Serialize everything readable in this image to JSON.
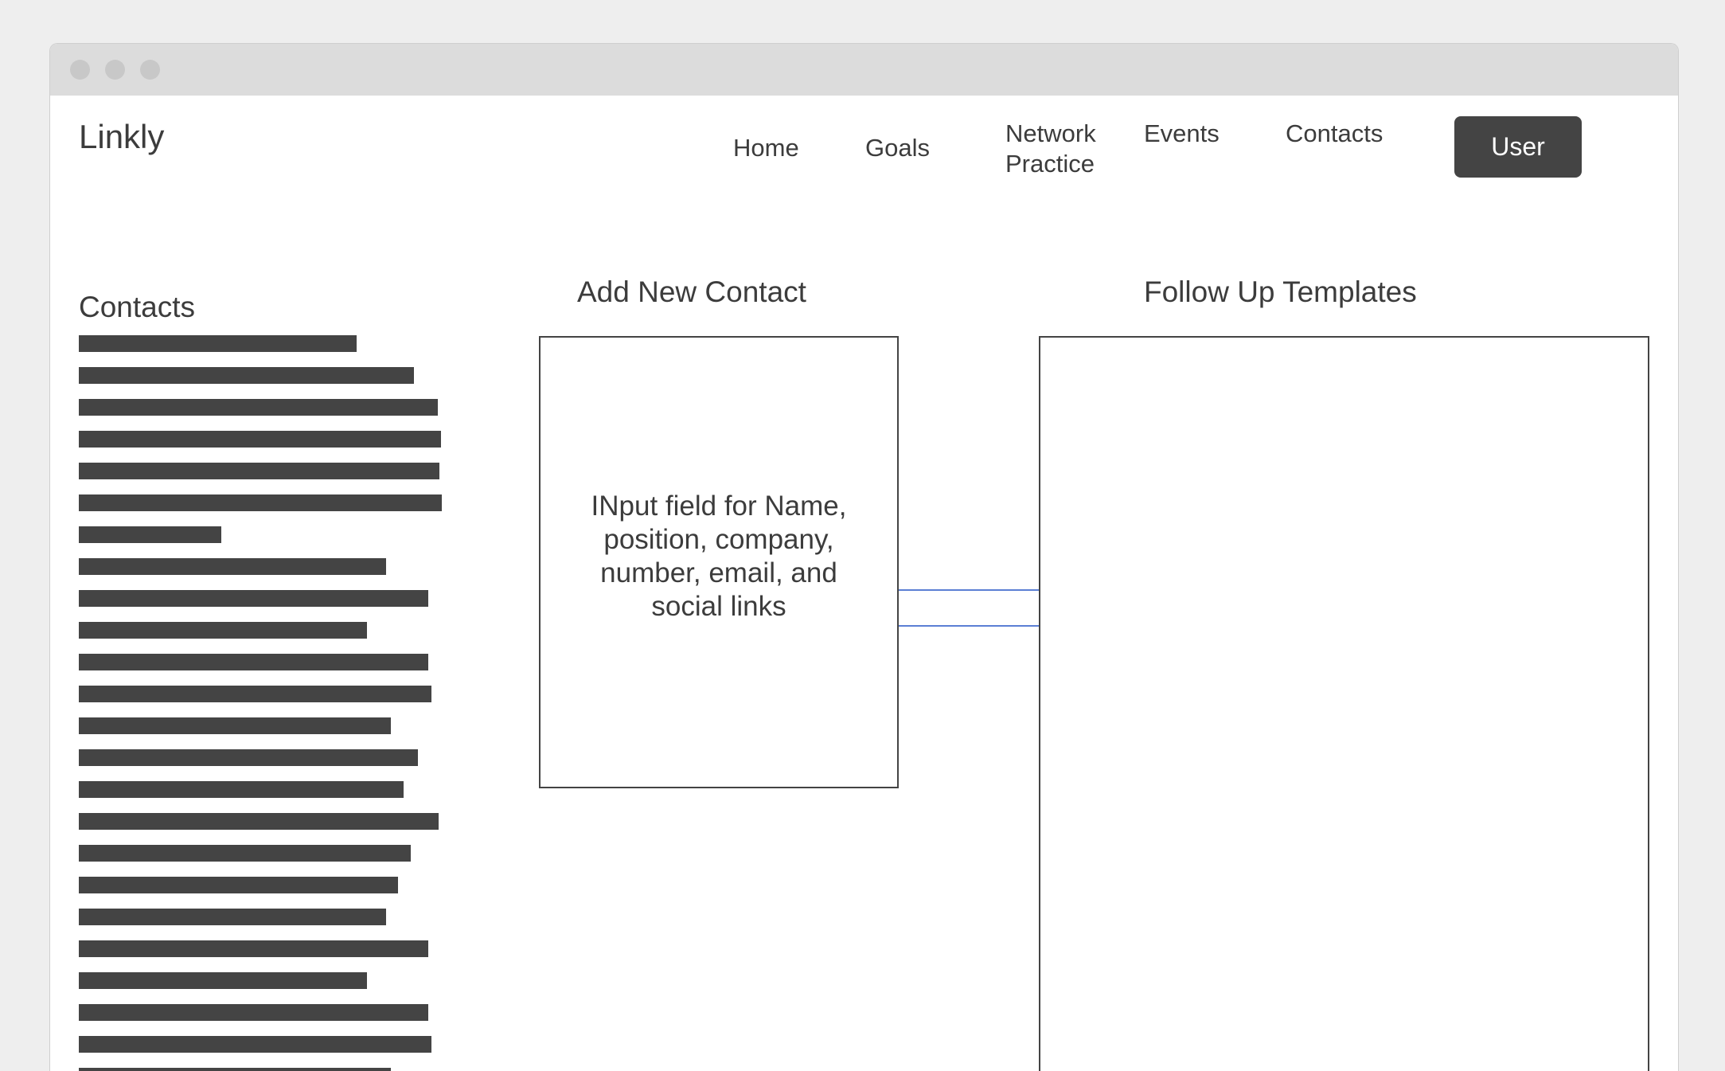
{
  "window": {
    "controls": [
      "close",
      "minimize",
      "maximize"
    ]
  },
  "header": {
    "logo": "Linkly",
    "nav": [
      {
        "label": "Home"
      },
      {
        "label": "Goals"
      },
      {
        "label": "Network Practice"
      },
      {
        "label": "Events"
      },
      {
        "label": "Contacts"
      }
    ],
    "user_label": "User"
  },
  "contacts": {
    "title": "Contacts",
    "rows": 24
  },
  "add_contact": {
    "title": "Add New Contact",
    "placeholder": "INput field for Name, position, company, number, email, and social links"
  },
  "templates": {
    "title": "Follow Up Templates"
  },
  "colors": {
    "dark": "#444444",
    "connector": "#5b7fd4",
    "titlebar": "#dcdcdc"
  }
}
